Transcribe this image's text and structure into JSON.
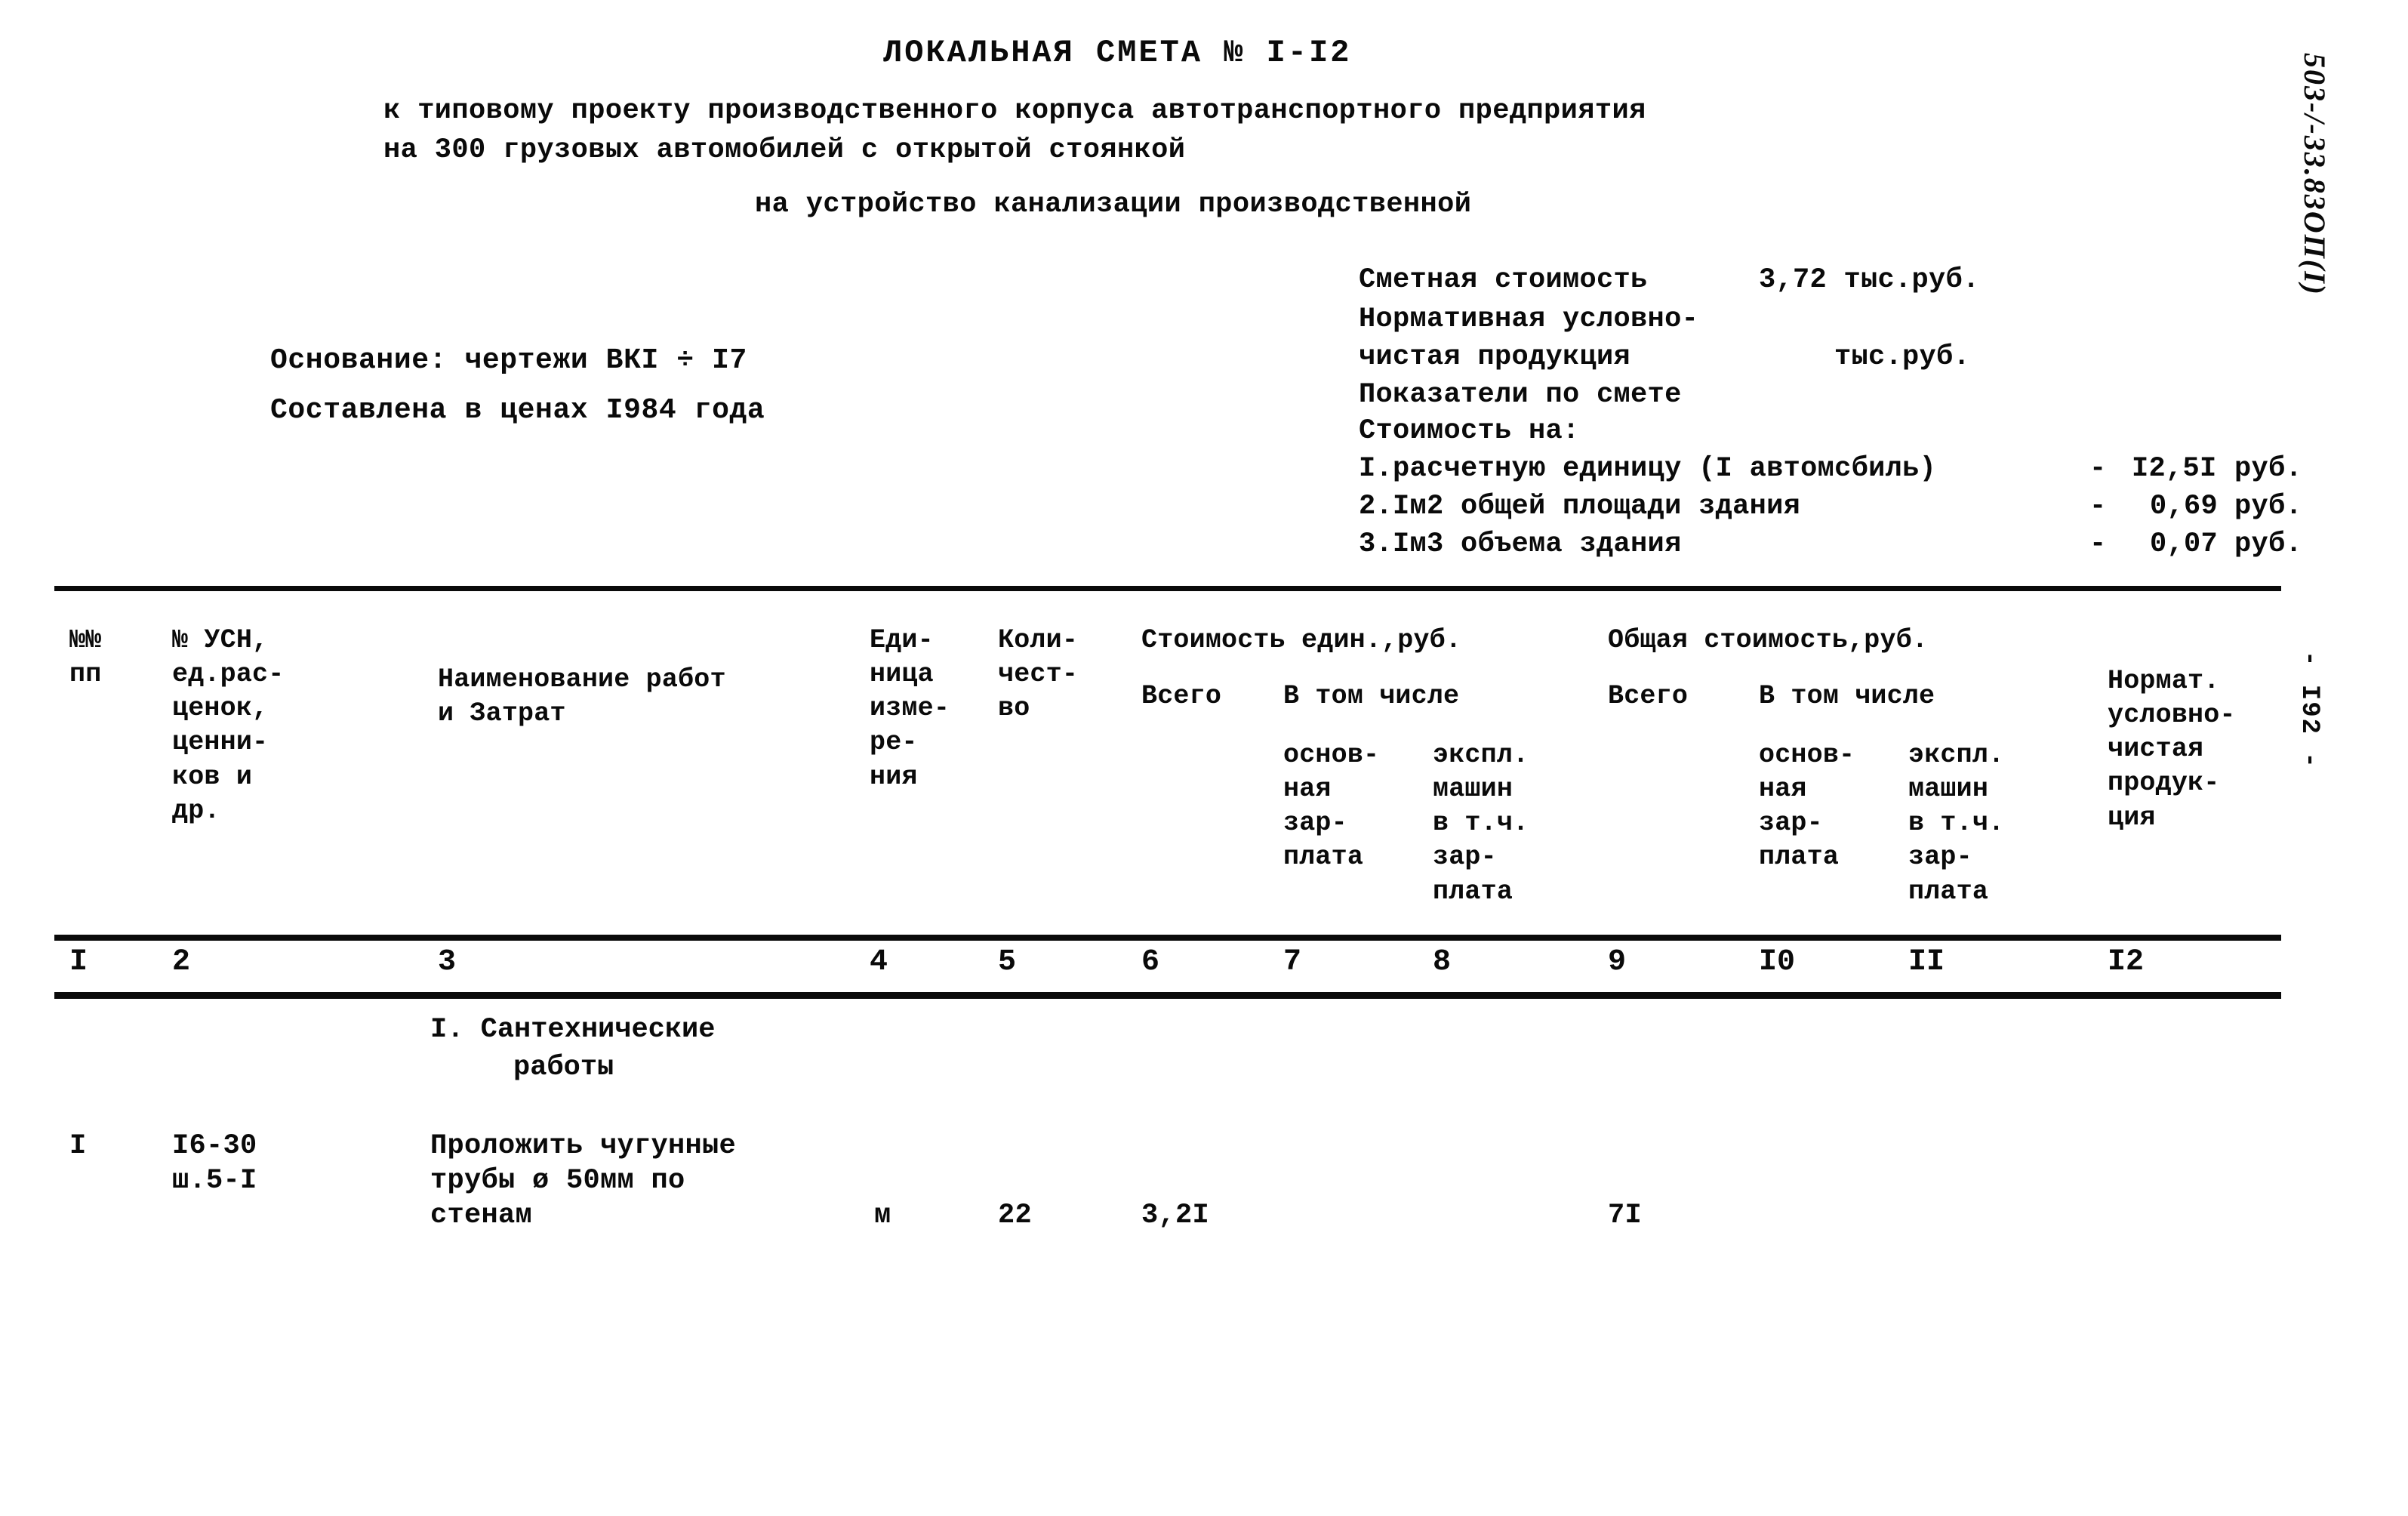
{
  "document": {
    "title": "ЛОКАЛЬНАЯ СМЕТА № I-I2",
    "subtitle_line1": "к типовому проекту производственного корпуса автотранспортного предприятия",
    "subtitle_line2": "на 300 грузовых автомобилей с открытой стоянкой",
    "subtitle_line3": "на устройство канализации производственной",
    "margin_code": "503-/-33.83ОП(I)",
    "page_marker": "- I92 -"
  },
  "basis": {
    "line1": "Основание: чертежи ВКI ÷ I7",
    "line2": "Составлена в ценах I984 года"
  },
  "summary": {
    "estimate_cost_label": "Сметная стоимость",
    "estimate_cost_value": "3,72 тыс.руб.",
    "nchp_label_line1": "Нормативная условно-",
    "nchp_label_line2": "чистая продукция",
    "nchp_units": "тыс.руб.",
    "indicators_label": "Показатели по смете",
    "cost_per_label": "Стоимость на:",
    "items": [
      {
        "label": "I.расчетную единицу (I автомсбиль)",
        "dash": "-",
        "value": "I2,5I",
        "units": "руб."
      },
      {
        "label": "2.Iм2 общей площади здания",
        "dash": "-",
        "value": "0,69",
        "units": "руб."
      },
      {
        "label": "3.Iм3 объема здания",
        "dash": "-",
        "value": "0,07",
        "units": "руб."
      }
    ]
  },
  "table": {
    "headers": {
      "col1": "№№\nпп",
      "col2": "№ УСН,\nед.рас-\nценок,\nценни-\nков и\nдр.",
      "col3": "Наименование работ\nи Затрат",
      "col4": "Еди-\nница\nизме-\nре-\nния",
      "col5": "Коли-\nчест-\nво",
      "group_unit_cost": "Стоимость един.,руб.",
      "col6": "Всего",
      "group_unit_incl": "В том числе",
      "col7": "основ-\nная\nзар-\nплата",
      "col8": "экспл.\nмашин\nв т.ч.\nзар-\nплата",
      "group_total_cost": "Общая стоимость,руб.",
      "col9": "Всего",
      "group_total_incl": "В том числе",
      "col10": "основ-\nная\nзар-\nплата",
      "col11": "экспл.\nмашин\nв т.ч.\nзар-\nплата",
      "col12": "Нормат.\nусловно-\nчистая\nпродук-\nция"
    },
    "column_numbers": [
      "I",
      "2",
      "3",
      "4",
      "5",
      "6",
      "7",
      "8",
      "9",
      "I0",
      "II",
      "I2"
    ],
    "section": {
      "line1": "I. Сантехнические",
      "line2": "работы"
    },
    "rows": [
      {
        "num": "I",
        "code_line1": "I6-30",
        "code_line2": "ш.5-I",
        "name_line1": "Проложить чугунные",
        "name_line2": "трубы ø 50мм по",
        "name_line3": "стенам",
        "unit": "м",
        "qty": "22",
        "unit_total": "3,2I",
        "unit_wage": "",
        "unit_machine": "",
        "grand_total": "7I",
        "total_wage": "",
        "total_machine": "",
        "nchp": ""
      }
    ]
  }
}
